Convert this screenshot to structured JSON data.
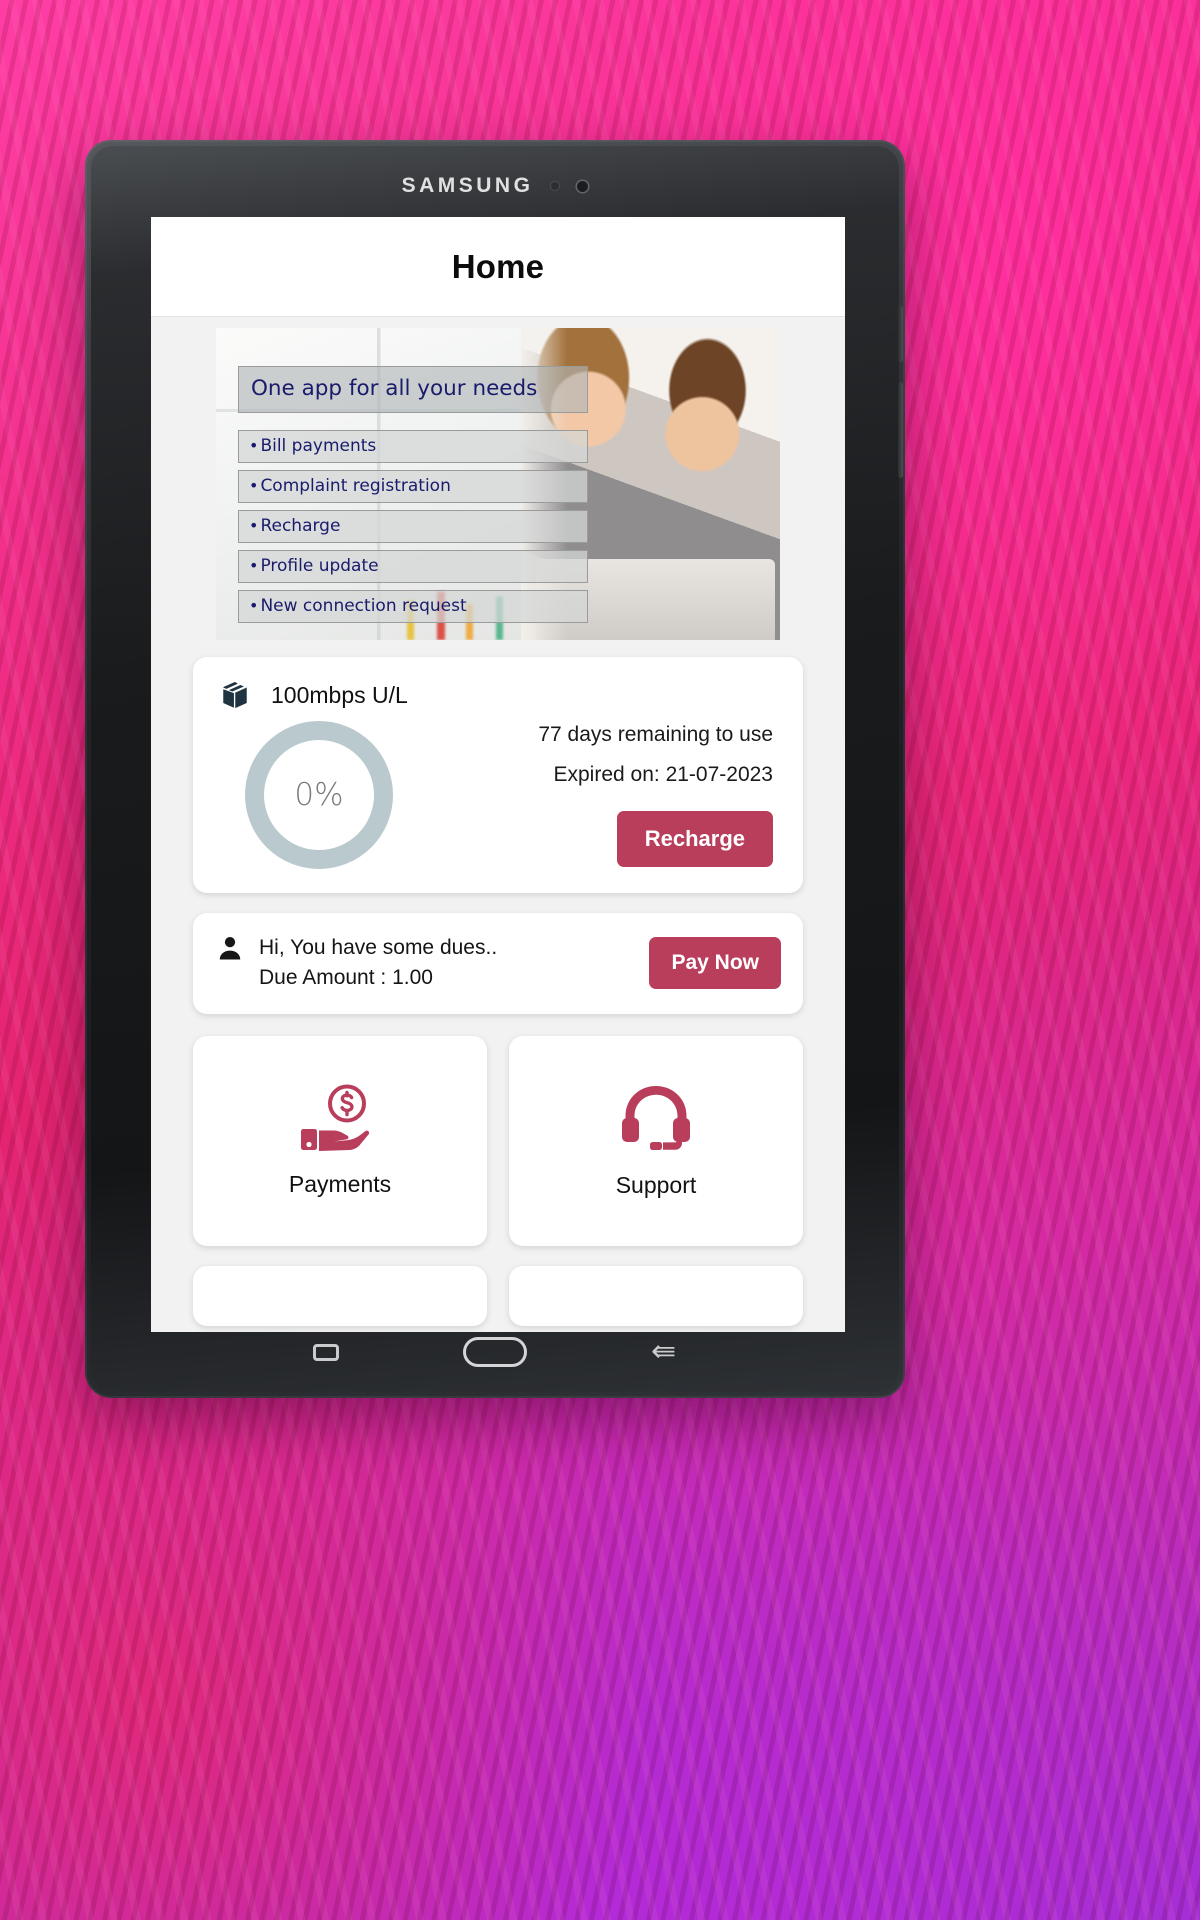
{
  "device": {
    "brand": "SAMSUNG",
    "camera_icon": "front-camera-icon",
    "sensor_icon": "proximity-sensor-icon",
    "nav": {
      "recent_label": "recent-apps",
      "home_label": "home",
      "back_label": "back"
    }
  },
  "header": {
    "title": "Home"
  },
  "banner": {
    "headline": "One app for all your needs",
    "items": [
      "Bill payments",
      "Complaint registration",
      "Recharge",
      "Profile update",
      "New connection request"
    ],
    "bullet": "•"
  },
  "plan_card": {
    "package_icon": "package-box-icon",
    "plan_name": "100mbps U/L",
    "usage_percent": "0%",
    "days_remaining": "77 days remaining to use",
    "expiry": "Expired on: 21-07-2023",
    "recharge_label": "Recharge",
    "ring_color": "#b9c9cd",
    "accent_color": "#b83e5c"
  },
  "dues_card": {
    "person_icon": "person-icon",
    "message": "Hi, You have some dues..",
    "due_amount": "Due Amount : 1.00",
    "pay_label": "Pay Now"
  },
  "tiles": [
    {
      "label": "Payments",
      "icon": "hand-holding-dollar-icon"
    },
    {
      "label": "Support",
      "icon": "headset-icon"
    }
  ],
  "colors": {
    "accent": "#b83e5c",
    "banner_text": "#191b6b",
    "ring": "#b9c9cd",
    "page_bg": "#f2f2f2"
  }
}
